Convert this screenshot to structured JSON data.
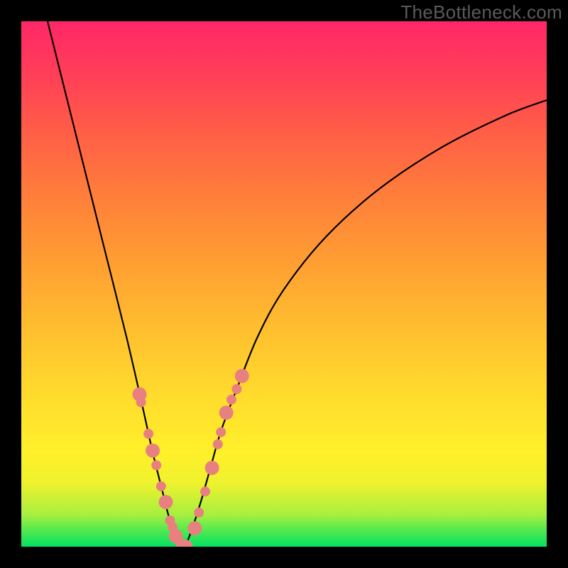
{
  "watermark": "TheBottleneck.com",
  "chart_data": {
    "type": "line",
    "title": "",
    "xlabel": "",
    "ylabel": "",
    "xlim": [
      0,
      100
    ],
    "ylim": [
      0,
      100
    ],
    "grid": false,
    "series": [
      {
        "name": "left-curve",
        "x": [
          5,
          8,
          12,
          16,
          20,
          23,
          25,
          27,
          28,
          29,
          30,
          31
        ],
        "y": [
          100,
          88,
          72,
          56,
          40,
          27,
          18,
          10,
          6,
          3,
          1,
          0
        ]
      },
      {
        "name": "right-curve",
        "x": [
          31,
          32,
          34,
          36,
          38,
          41,
          45,
          50,
          58,
          68,
          80,
          92,
          100
        ],
        "y": [
          0,
          2,
          8,
          15,
          22,
          30,
          40,
          49,
          59,
          68,
          76,
          82,
          85
        ]
      },
      {
        "name": "left-dots",
        "x": [
          22.5,
          22.8,
          24.2,
          25.0,
          25.7,
          26.6,
          27.5,
          28.3,
          28.8,
          29.4,
          30.2,
          30.8,
          31.3
        ],
        "y": [
          29.0,
          27.5,
          21.5,
          18.3,
          15.5,
          11.5,
          8.5,
          5.0,
          3.7,
          2.0,
          0.8,
          0.2,
          0.0
        ]
      },
      {
        "name": "right-dots",
        "x": [
          33.0,
          33.8,
          35.0,
          36.3,
          37.4,
          38.0,
          39.0,
          40.0,
          41.0,
          42.0
        ],
        "y": [
          3.5,
          6.5,
          10.5,
          15.0,
          19.5,
          21.8,
          25.5,
          28.0,
          30.0,
          32.5
        ]
      }
    ],
    "dot_color": "#e98080",
    "curve_color": "#000000",
    "curve_width": 2.2,
    "dot_radius_major": 10,
    "dot_radius_minor": 7
  }
}
